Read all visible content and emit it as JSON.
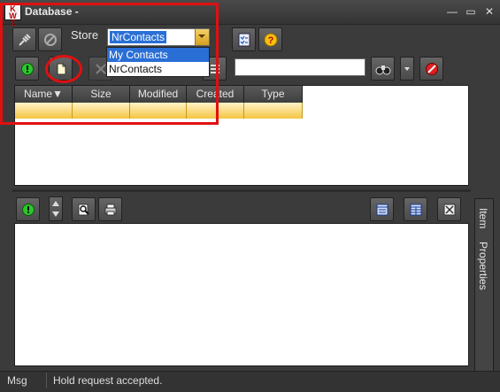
{
  "window": {
    "title": "Database -",
    "icon": "app-icon",
    "controls": {
      "minimize": "—",
      "maximize": "▭",
      "close": "✕"
    }
  },
  "toolbar": {
    "store_label": "Store",
    "store_value": "NrContacts",
    "store_options": [
      "My Contacts",
      "NrContacts"
    ],
    "search_value": ""
  },
  "table": {
    "columns": [
      "Name",
      "Size",
      "Modified",
      "Created",
      "Type"
    ],
    "sort_indicator": "▼"
  },
  "side_tabs": [
    "Item",
    "Properties"
  ],
  "status": {
    "label": "Msg",
    "text": "Hold request accepted."
  },
  "colors": {
    "background": "#3b3b3b",
    "selection": "#2a6fd6",
    "row_highlight": "#f5c542",
    "annotation": "#e01010"
  }
}
